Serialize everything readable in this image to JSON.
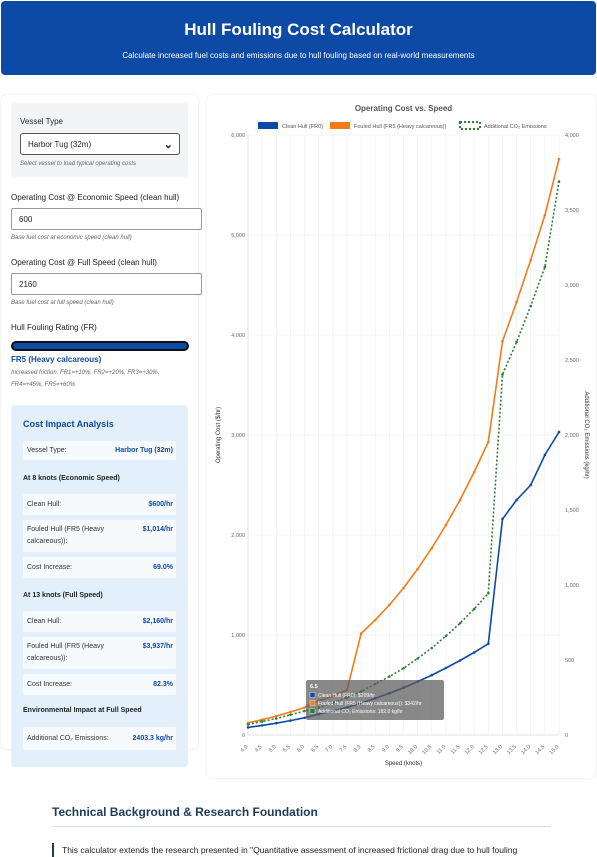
{
  "header": {
    "title": "Hull Fouling Cost Calculator",
    "subtitle": "Calculate increased fuel costs and emissions due to hull fouling based on real-world measurements"
  },
  "vessel": {
    "label": "Vessel Type",
    "selected": "Harbor Tug (32m)",
    "hint": "Select vessel to load typical operating costs"
  },
  "economic": {
    "label": "Operating Cost @ Economic Speed (clean hull)",
    "value": "600",
    "hint": "Base fuel cost at economic speed (clean hull)"
  },
  "full": {
    "label": "Operating Cost @ Full Speed (clean hull)",
    "value": "2160",
    "hint": "Base fuel cost at full speed (clean hull)"
  },
  "fouling": {
    "label": "Hull Fouling Rating (FR)",
    "slider_level": 1.0,
    "value": "FR5 (Heavy calcareous)",
    "hint_line1": "Increased friction: FR1=+10%, FR2=+20%, FR3=+30%,",
    "hint_line2": "FR4=+45%, FR5=+60%"
  },
  "impact": {
    "title": "Cost Impact Analysis",
    "vessel_key": "Vessel Type:",
    "vessel_val": "Harbor Tug (32m)",
    "eco_title": "At 8 knots (Economic Speed)",
    "eco_clean_key": "Clean Hull:",
    "eco_clean_val": "$600/hr",
    "eco_fouled_key1": "Fouled Hull (FR5 (Heavy",
    "eco_fouled_key2": "calcareous)):",
    "eco_fouled_val": "$1,014/hr",
    "eco_inc_key": "Cost Increase:",
    "eco_inc_val": "69.0%",
    "full_title": "At 13 knots (Full Speed)",
    "full_clean_key": "Clean Hull:",
    "full_clean_val": "$2,160/hr",
    "full_fouled_key1": "Fouled Hull (FR5 (Heavy",
    "full_fouled_key2": "calcareous)):",
    "full_fouled_val": "$3,937/hr",
    "full_inc_key": "Cost Increase:",
    "full_inc_val": "82.3%",
    "env_title": "Environmental Impact at Full Speed",
    "env_key": "Additional CO₂ Emissions:",
    "env_val": "2403.3 kg/hr"
  },
  "tooltip": {
    "title": "6.5",
    "line1": "Clean Hull (FR0): $209/hr",
    "line2": "Fouled Hull (FR5 (Heavy calcareous)): $342/hr",
    "line3": "Additional CO₂ Emissions: 182.0 kg/hr"
  },
  "chart_data": {
    "type": "line",
    "title": "Operating Cost vs. Speed",
    "xlabel": "Speed (knots)",
    "ylabel": "Operating Cost ($/hr)",
    "y2label": "Additional CO₂ Emissions (kg/hr)",
    "x": [
      "4.0",
      "4.5",
      "5.0",
      "5.5",
      "6.0",
      "6.5",
      "7.0",
      "7.5",
      "8.0",
      "8.5",
      "9.0",
      "9.5",
      "10.0",
      "10.5",
      "11.0",
      "11.5",
      "12.0",
      "12.5",
      "13.0",
      "13.5",
      "14.0",
      "14.5",
      "15.0"
    ],
    "xlim": [
      4,
      15
    ],
    "ylim": [
      0,
      6000
    ],
    "y2lim": [
      0,
      4000
    ],
    "yticks": [
      "0",
      "1,000",
      "2,000",
      "3,000",
      "4,000",
      "5,000",
      "6,000"
    ],
    "y2ticks": [
      "0",
      "500",
      "1,000",
      "1,500",
      "2,000",
      "2,500",
      "3,000",
      "3,500",
      "4,000"
    ],
    "legend_position": "top",
    "grid": true,
    "series": [
      {
        "name": "Clean Hull (FR0)",
        "color": "#0d4aa6",
        "axis": "left",
        "style": "solid",
        "values": [
          76,
          96,
          118,
          144,
          172,
          209,
          238,
          276,
          319,
          366,
          418,
          473,
          534,
          599,
          670,
          745,
          826,
          912,
          2160,
          2350,
          2500,
          2800,
          3030
        ]
      },
      {
        "name": "Fouled Hull (FR5 (Heavy calcareous))",
        "color": "#f07c1a",
        "axis": "left",
        "style": "solid",
        "values": [
          121,
          153,
          189,
          230,
          275,
          342,
          388,
          450,
          1014,
          1150,
          1300,
          1470,
          1660,
          1870,
          2100,
          2350,
          2630,
          2930,
          3937,
          4330,
          4750,
          5200,
          5760
        ]
      },
      {
        "name": "Additional CO₂ Emissions",
        "color": "#2e7d32",
        "axis": "right",
        "style": "dotted",
        "values": [
          70,
          90,
          110,
          135,
          160,
          182,
          215,
          250,
          290,
          340,
          390,
          445,
          510,
          580,
          660,
          745,
          840,
          945,
          2403.3,
          2620,
          2860,
          3120,
          3690
        ]
      }
    ]
  }
}
